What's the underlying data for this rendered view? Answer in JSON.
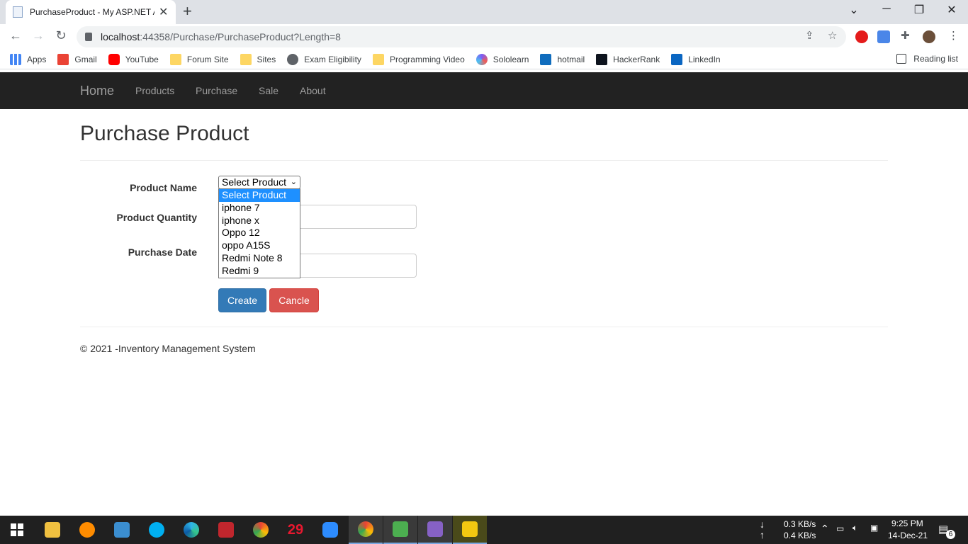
{
  "browser": {
    "tab_title": "PurchaseProduct - My ASP.NET A",
    "url_host": "localhost",
    "url_rest": ":44358/Purchase/PurchaseProduct?Length=8",
    "bookmarks": [
      "Apps",
      "Gmail",
      "YouTube",
      "Forum Site",
      "Sites",
      "Exam Eligibility",
      "Programming Video",
      "Sololearn",
      "hotmail",
      "HackerRank",
      "LinkedIn"
    ],
    "reading_list": "Reading list"
  },
  "navbar": {
    "brand": "Home",
    "links": [
      "Products",
      "Purchase",
      "Sale",
      "About"
    ]
  },
  "page": {
    "title": "Purchase Product",
    "form": {
      "product_name_label": "Product Name",
      "product_quantity_label": "Product Quantity",
      "purchase_date_label": "Purchase Date",
      "select_value": "Select Product",
      "options": [
        "Select Product",
        "iphone 7",
        "iphone x",
        "Oppo 12",
        "oppo A15S",
        "Redmi Note 8",
        "Redmi 9"
      ],
      "create_label": "Create",
      "cancel_label": "Cancle"
    },
    "footer": "© 2021 -Inventory Management System"
  },
  "taskbar": {
    "net_down": "0.3 KB/s",
    "net_up": "0.4 KB/s",
    "time": "9:25 PM",
    "date": "14-Dec-21",
    "notifications": "6",
    "badge_29": "29"
  },
  "colors": {
    "navbar_bg": "#222222",
    "primary": "#337ab7",
    "danger": "#d9534f",
    "selected_option": "#1e90ff"
  }
}
